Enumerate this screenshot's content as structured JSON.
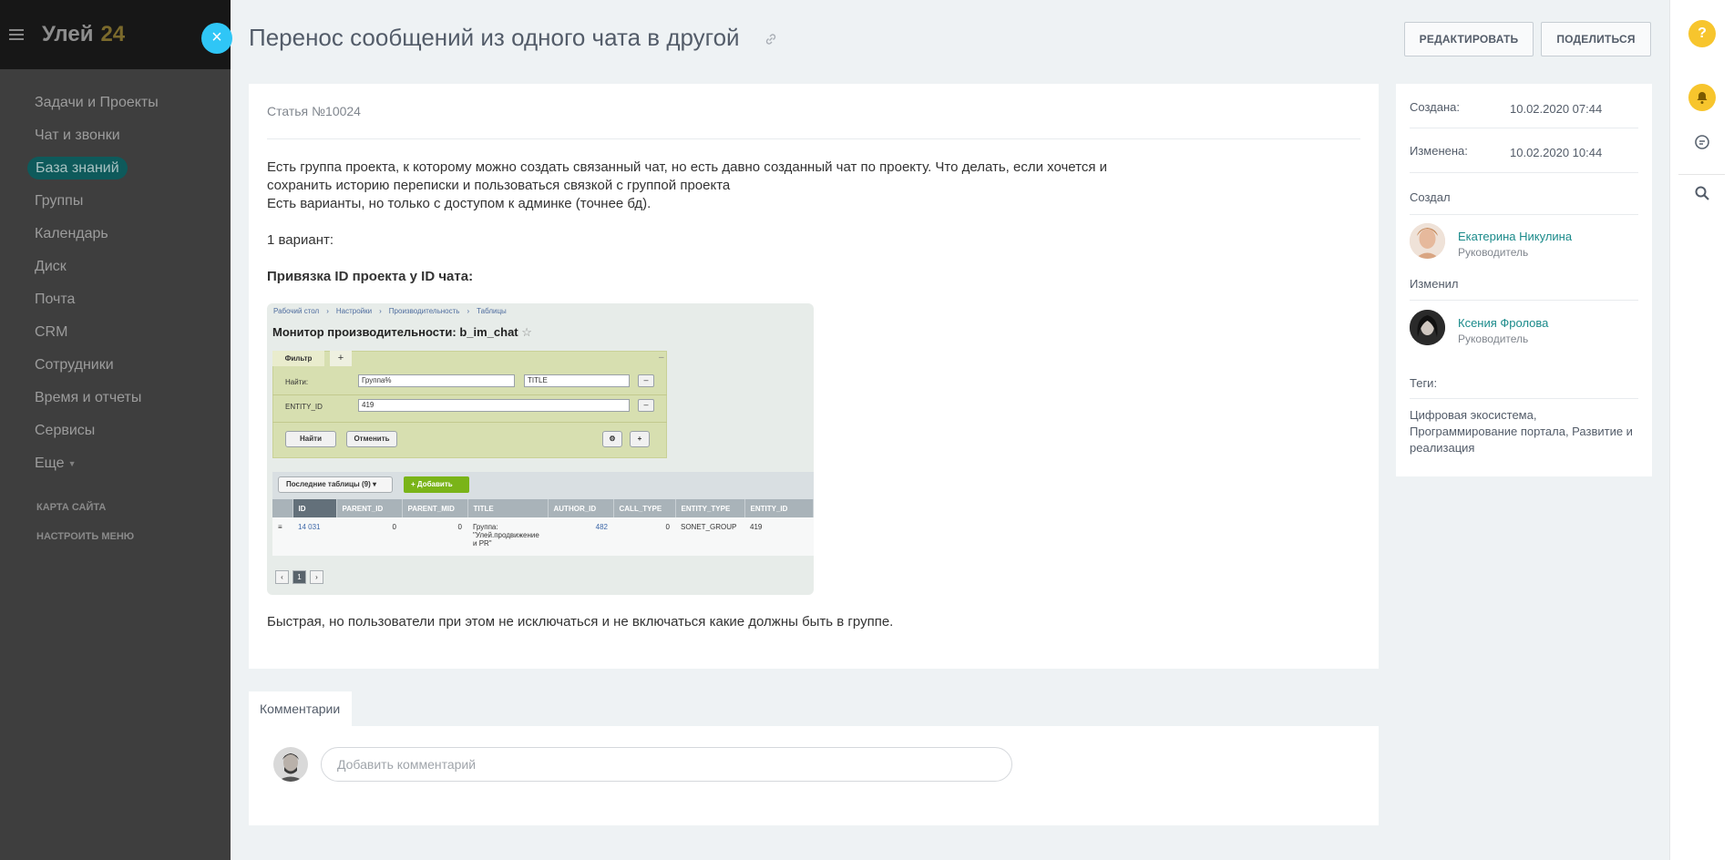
{
  "app": {
    "logo_name": "Улей",
    "logo_number": "24"
  },
  "sidebar": {
    "items": [
      {
        "label": "Задачи и Проекты"
      },
      {
        "label": "Чат и звонки"
      },
      {
        "label": "База знаний"
      },
      {
        "label": "Группы"
      },
      {
        "label": "Календарь"
      },
      {
        "label": "Диск"
      },
      {
        "label": "Почта"
      },
      {
        "label": "CRM"
      },
      {
        "label": "Сотрудники"
      },
      {
        "label": "Время и отчеты"
      },
      {
        "label": "Сервисы"
      },
      {
        "label": "Еще"
      }
    ],
    "site_map": "КАРТА САЙТА",
    "configure_menu": "НАСТРОИТЬ МЕНЮ"
  },
  "header": {
    "title": "Перенос сообщений из одного чата в другой",
    "edit_label": "РЕДАКТИРОВАТЬ",
    "share_label": "ПОДЕЛИТЬСЯ"
  },
  "article": {
    "number": "Статья №10024",
    "para1_line1": "Есть группа проекта, к которому можно создать связанный чат, но есть давно созданный чат по проекту. Что делать, если хочется и",
    "para1_line2": "сохранить историю переписки и пользоваться связкой с группой проекта",
    "para1_line3": "Есть варианты, но только с доступом к админке (точнее бд).",
    "variant": "1 вариант:",
    "binding": "Привязка ID проекта у ID чата:",
    "conclusion": "Быстрая, но пользователи при этом не исключаться и не включаться какие должны быть в группе."
  },
  "screenshot": {
    "crumbs": [
      "Рабочий стол",
      "›",
      "Настройки",
      "›",
      "Производительность",
      "›",
      "Таблицы"
    ],
    "title": "Монитор производительности: b_im_chat",
    "filter_tab": "Фильтр",
    "find_label": "Найти:",
    "find_value": "Группа%",
    "find_select": "TITLE",
    "entity_label": "ENTITY_ID",
    "entity_value": "419",
    "btn_find": "Найти",
    "btn_cancel": "Отменить",
    "recent_tables": "Последние таблицы (9)",
    "add_label": "Добавить",
    "columns": [
      "ID",
      "PARENT_ID",
      "PARENT_MID",
      "TITLE",
      "AUTHOR_ID",
      "CALL_TYPE",
      "ENTITY_TYPE",
      "ENTITY_ID"
    ],
    "row": [
      "14 031",
      "0",
      "0",
      "Группа: \"Улей.продвижение и PR\"",
      "482",
      "0",
      "SONET_GROUP",
      "419"
    ],
    "page": "1"
  },
  "info": {
    "created_label": "Создана:",
    "created_value": "10.02.2020 07:44",
    "changed_label": "Изменена:",
    "changed_value": "10.02.2020 10:44",
    "creator_label": "Создал",
    "creator_name": "Екатерина Никулина",
    "creator_role": "Руководитель",
    "modifier_label": "Изменил",
    "modifier_name": "Ксения Фролова",
    "modifier_role": "Руководитель",
    "tags_label": "Теги:",
    "tags_value": "Цифровая экосистема, Программирование портала, Развитие и реализация"
  },
  "comments": {
    "tab_label": "Комментарии",
    "placeholder": "Добавить комментарий"
  },
  "colors": {
    "accent_close": "#2fc6f6",
    "accent_yellow": "#f7c52d",
    "link_teal": "#1a8a8a",
    "active_menu": "#0e5a5b"
  }
}
